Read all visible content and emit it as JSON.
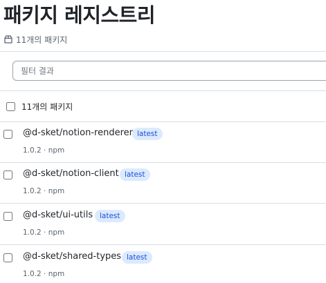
{
  "page": {
    "title": "패키지 레지스트리",
    "subtitle_count": "11개의 패키지",
    "subtitle_icon": "package-icon"
  },
  "filter": {
    "placeholder": "필터 결과",
    "value": ""
  },
  "list_header": {
    "select_all_checked": false,
    "count_label": "11개의 패키지"
  },
  "packages": [
    {
      "name": "@d-sket/notion-renderer",
      "tag": "latest",
      "meta": "1.0.2 · npm",
      "checked": false
    },
    {
      "name": "@d-sket/notion-client",
      "tag": "latest",
      "meta": "1.0.2 · npm",
      "checked": false
    },
    {
      "name": "@d-sket/ui-utils",
      "tag": "latest",
      "meta": "1.0.2 · npm",
      "checked": false
    },
    {
      "name": "@d-sket/shared-types",
      "tag": "latest",
      "meta": "1.0.2 · npm",
      "checked": false
    }
  ],
  "colors": {
    "badge_bg": "#dbeafe",
    "badge_text": "#1d4ed8",
    "divider": "#d8dee4",
    "text_primary": "#1f2328",
    "text_muted": "#59636e"
  }
}
